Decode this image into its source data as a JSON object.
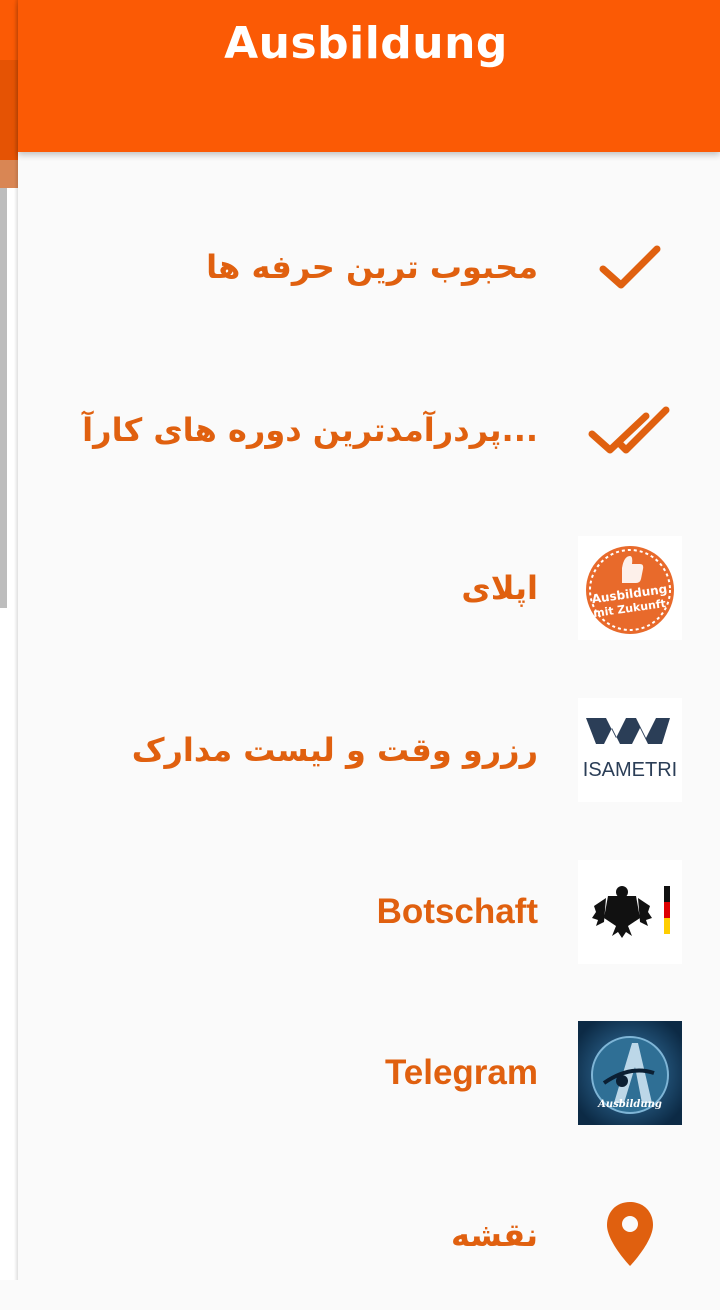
{
  "app": {
    "title": "Ausbildung",
    "accent_color": "#fb5a05",
    "label_color": "#e0600f"
  },
  "menu": {
    "items": [
      {
        "label": "محبوب ترین حرفه ها",
        "icon": "check-icon"
      },
      {
        "label": "پردرآمدترین دوره های کارآ...",
        "icon": "double-check-icon"
      },
      {
        "label": "اپلای",
        "icon": "ausbildung-mit-zukunft-logo",
        "logo_text": [
          "Ausbildung",
          "mit Zukunft"
        ]
      },
      {
        "label": "رزرو وقت و لیست مدارک",
        "icon": "visametric-logo",
        "logo_text": "ISAMETRI"
      },
      {
        "label": "Botschaft",
        "icon": "german-eagle-flag-logo"
      },
      {
        "label": "Telegram",
        "icon": "ausbildung-telegram-logo",
        "logo_text": "Ausbildung"
      },
      {
        "label": "نقشه",
        "icon": "location-pin-icon"
      }
    ]
  }
}
